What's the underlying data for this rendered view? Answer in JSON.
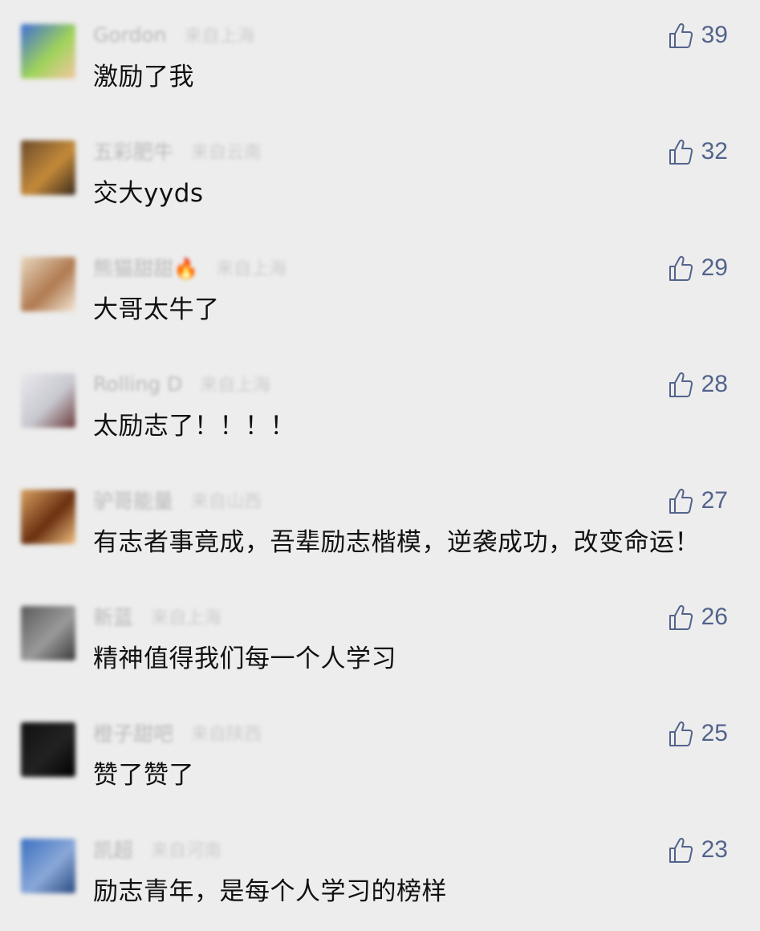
{
  "comments": [
    {
      "author": "Gordon",
      "location": "来自上海",
      "text": "激励了我",
      "likes": "39",
      "avatar_colors": [
        "#3f6ed6",
        "#9fd35a",
        "#f2c7a0"
      ]
    },
    {
      "author": "五彩肥牛",
      "location": "来自云南",
      "text": "交大yyds",
      "likes": "32",
      "avatar_colors": [
        "#6a4a2a",
        "#c48a3a",
        "#3a2a1a"
      ]
    },
    {
      "author": "熊猫甜甜🔥",
      "location": "来自上海",
      "text": "大哥太牛了",
      "likes": "29",
      "avatar_colors": [
        "#e8d8c0",
        "#b07a50",
        "#f3e7d5"
      ]
    },
    {
      "author": "Rolling D",
      "location": "来自上海",
      "text": "太励志了！！！！",
      "likes": "28",
      "avatar_colors": [
        "#e8e8ec",
        "#c8c8d0",
        "#6a3a3a"
      ]
    },
    {
      "author": "驴哥能量",
      "location": "来自山西",
      "text": "有志者事竟成，吾辈励志楷模，逆袭成功，改变命运！",
      "likes": "27",
      "avatar_colors": [
        "#d8a060",
        "#6a3010",
        "#f0c080"
      ]
    },
    {
      "author": "新蓝",
      "location": "来自上海",
      "text": "精神值得我们每一个人学习",
      "likes": "26",
      "avatar_colors": [
        "#5a5a5a",
        "#9a9a9a",
        "#3a3a3a"
      ]
    },
    {
      "author": "橙子甜吧",
      "location": "来自陕西",
      "text": "赞了赞了",
      "likes": "25",
      "avatar_colors": [
        "#111111",
        "#222222",
        "#000000"
      ]
    },
    {
      "author": "凯超",
      "location": "来自河南",
      "text": "励志青年，是每个人学习的榜样",
      "likes": "23",
      "avatar_colors": [
        "#3a70c0",
        "#8aa8d8",
        "#2a4a80"
      ]
    }
  ],
  "colors": {
    "background": "#ededed",
    "like_accent": "#53648c",
    "comment_text": "#111111"
  },
  "icons": {
    "like": "thumbs-up-icon"
  }
}
